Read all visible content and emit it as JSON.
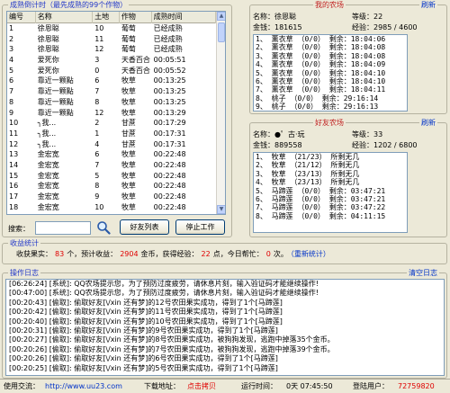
{
  "crop_panel": {
    "legend": "成熟倒计时（最先成熟的99个作物）",
    "columns": [
      "编号",
      "名称",
      "土地",
      "作物",
      "成熟时间"
    ],
    "rows": [
      [
        "1",
        "徐恩聪",
        "10",
        "葡萄",
        "已经成熟"
      ],
      [
        "2",
        "徐恩聪",
        "11",
        "葡萄",
        "已经成熟"
      ],
      [
        "3",
        "徐恩聪",
        "12",
        "葡萄",
        "已经成熟"
      ],
      [
        "4",
        "爱死你",
        "3",
        "天香百合",
        "00:05:51"
      ],
      [
        "5",
        "爱死你",
        "0",
        "天香百合",
        "00:05:52"
      ],
      [
        "6",
        "靠近一颗點",
        "6",
        "牧草",
        "00:13:25"
      ],
      [
        "7",
        "靠近一颗點",
        "7",
        "牧草",
        "00:13:25"
      ],
      [
        "8",
        "靠近一颗點",
        "8",
        "牧草",
        "00:13:25"
      ],
      [
        "9",
        "靠近一颗點",
        "12",
        "牧草",
        "00:13:29"
      ],
      [
        "10",
        "╮我...",
        "2",
        "甘蔗",
        "00:17:29"
      ],
      [
        "11",
        "╮我...",
        "1",
        "甘蔗",
        "00:17:31"
      ],
      [
        "12",
        "╮我...",
        "4",
        "甘蔗",
        "00:17:31"
      ],
      [
        "13",
        "金宏宽",
        "6",
        "牧草",
        "00:22:48"
      ],
      [
        "14",
        "金宏宽",
        "7",
        "牧草",
        "00:22:48"
      ],
      [
        "15",
        "金宏宽",
        "5",
        "牧草",
        "00:22:48"
      ],
      [
        "16",
        "金宏宽",
        "8",
        "牧草",
        "00:22:48"
      ],
      [
        "17",
        "金宏宽",
        "9",
        "牧草",
        "00:22:48"
      ],
      [
        "18",
        "金宏宽",
        "10",
        "牧草",
        "00:22:48"
      ]
    ],
    "search_label": "搜索：",
    "search_value": "",
    "friend_list_button": "好友列表",
    "stop_button": "停止工作"
  },
  "my_farm": {
    "legend": "我的农场",
    "refresh": "刷新",
    "name_label": "名称：",
    "name": "徐恩聪",
    "level_label": "等级：",
    "level": "22",
    "gold_label": "金钱：",
    "gold": "181615",
    "exp_label": "经验：",
    "exp": "2985 / 4600",
    "plots": [
      "1、 薰衣草 （0/0） 剩余：18:04:06",
      "2、 薰衣草 （0/0） 剩余：18:04:08",
      "3、 薰衣草 （0/0） 剩余：18:04:08",
      "4、 薰衣草 （0/0） 剩余：18:04:09",
      "5、 薰衣草 （0/0） 剩余：18:04:10",
      "6、 薰衣草 （0/0） 剩余：18:04:10",
      "7、 薰衣草 （0/0） 剩余：18:04:11",
      "8、 桃子 （0/0） 剩余：29:16:14",
      "9、 桃子 （0/0） 剩余：29:16:13"
    ]
  },
  "friend_farm": {
    "legend": "好友农场",
    "refresh": "刷新",
    "name_label": "名称：",
    "name": "●゜古·玩",
    "level_label": "等级：",
    "level": "33",
    "gold_label": "金钱：",
    "gold": "889558",
    "exp_label": "经验：",
    "exp": "1202 / 6800",
    "plots": [
      "1、 牧草 （21/23） 所剩无几",
      "2、 牧草 （21/12） 所剩无几",
      "3、 牧草 （23/13） 所剩无几",
      "4、 牧草 （23/13） 所剩无几",
      "5、 马蹄莲 （0/0） 剩余：03:47:21",
      "6、 马蹄莲 （0/0） 剩余：03:47:21",
      "7、 马蹄莲 （0/0） 剩余：03:47:22",
      "8、 马蹄莲 （0/0） 剩余：04:11:15"
    ]
  },
  "stats": {
    "legend": "收益统计",
    "harvest_label": "收获果实：",
    "harvest_count": "83",
    "expected_label": "个，预计收益：",
    "expected_income": "2904",
    "exp_label": "金币，获得经验：",
    "exp_gained": "22",
    "help_label": "点，今日帮忙：",
    "help_count": "0",
    "times_label": "次。",
    "reset_link": "（重新统计）"
  },
  "log": {
    "legend": "操作日志",
    "clear_link": "清空日志",
    "lines": [
      "[06:26:24] [系统]: QQ农场提示您，为了预防过度疲劳，请休息片刻，输入验证码才能继续操作!",
      "[00:47:00] [系统]: QQ农场提示您，为了预防过度疲劳，请休息片刻，输入验证码才能继续操作!",
      "[00:20:43] [偷取]: 偷取好友[\\/xin 还有梦]的12号农田果实成功，得到了1个[马蹄莲]",
      "[00:20:42] [偷取]: 偷取好友[\\/xin 还有梦]的11号农田果实成功，得到了1个[马蹄莲]",
      "[00:20:40] [偷取]: 偷取好友[\\/xin 还有梦]的10号农田果实成功，得到了1个[马蹄莲]",
      "[00:20:31] [偷取]: 偷取好友[\\/xin 还有梦]的9号农田果实成功，得到了1个[马蹄莲]",
      "[00:20:27] [偷取]: 偷取好友[\\/xin 还有梦]的8号农田果实成功，被狗狗发现，逃跑中掉落35个金币。",
      "[00:20:26] [偷取]: 偷取好友[\\/xin 还有梦]的7号农田果实成功，被狗狗发现，逃跑中掉落39个金币。",
      "[00:20:26] [偷取]: 偷取好友[\\/xin 还有梦]的6号农田果实成功，得到了1个[马蹄莲]",
      "[00:20:25] [偷取]: 偷取好友[\\/xin 还有梦]的5号农田果实成功，得到了1个[马蹄莲]"
    ]
  },
  "statusbar": {
    "exchange_label": "使用交流：",
    "site_url": "http://www.uu23.com",
    "download_label": "下载地址：",
    "download_link": "点击拷贝",
    "runtime_label": "运行时间：",
    "runtime_value": "0天 07:45:50",
    "user_label": "登陆用户：",
    "user_value": "72759820"
  },
  "colors": {
    "window_bg": "#ece9d8",
    "legend_blue": "#2136c8",
    "legend_red": "#c02020",
    "link_blue": "#0032c8",
    "value_red": "#e00000"
  }
}
